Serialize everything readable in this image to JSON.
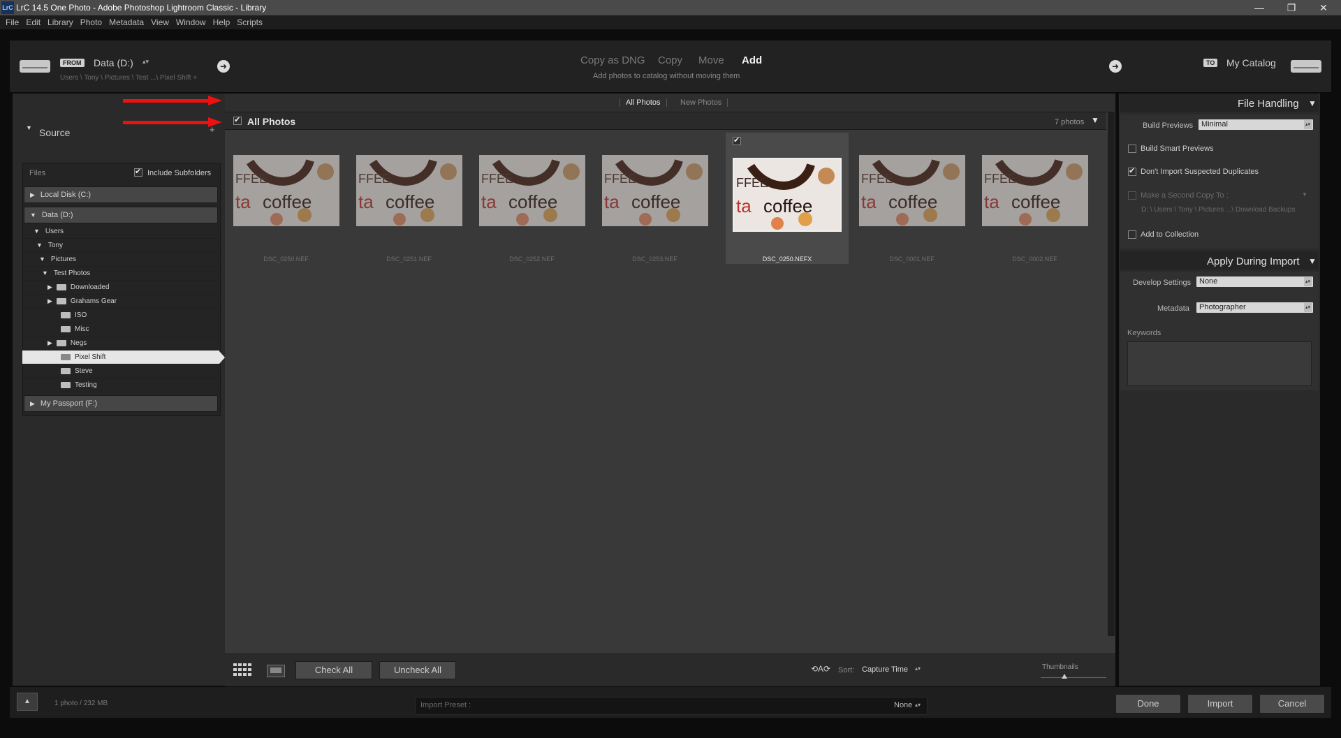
{
  "window": {
    "app_icon": "LrC",
    "title": "LrC 14.5 One Photo - Adobe Photoshop Lightroom Classic - Library",
    "min": "—",
    "max": "❐",
    "close": "✕"
  },
  "menu": [
    "File",
    "Edit",
    "Library",
    "Photo",
    "Metadata",
    "View",
    "Window",
    "Help",
    "Scripts"
  ],
  "header": {
    "from_tag": "FROM",
    "source_drive": "Data (D:)",
    "source_path": "Users \\ Tony \\ Pictures \\ Test ...\\ Pixel Shift +",
    "modes": [
      "Copy as DNG",
      "Copy",
      "Move",
      "Add"
    ],
    "active_mode": "Add",
    "mode_desc": "Add photos to catalog without moving them",
    "to_tag": "TO",
    "destination": "My Catalog",
    "arrow": "➜"
  },
  "left": {
    "source_label": "Source",
    "files_label": "Files",
    "include_subfolders": "Include Subfolders",
    "drives": {
      "c": "Local Disk (C:)",
      "d": "Data (D:)",
      "f": "My Passport (F:)"
    },
    "tree": {
      "users": "Users",
      "tony": "Tony",
      "pictures": "Pictures",
      "test_photos": "Test Photos",
      "downloaded": "Downloaded",
      "grahams_gear": "Grahams Gear",
      "iso": "ISO",
      "misc": "Misc",
      "negs": "Negs",
      "pixel_shift": "Pixel Shift",
      "steve": "Steve",
      "testing": "Testing"
    }
  },
  "center": {
    "filters": [
      "All Photos",
      "New Photos"
    ],
    "group_title": "All Photos",
    "photo_count": "7 photos",
    "thumb_text": {
      "coffee": "coffee",
      "fee": "FFEE",
      "ta": "ta"
    },
    "thumbs": [
      "DSC_0250.NEF",
      "DSC_0251.NEF",
      "DSC_0252.NEF",
      "DSC_0253.NEF",
      "DSC_0250.NEFX",
      "DSC_0001.NEF",
      "DSC_0002.NEF"
    ],
    "check_all": "Check All",
    "uncheck_all": "Uncheck All",
    "sort_label": "Sort:",
    "sort_value": "Capture Time",
    "thumbnails_label": "Thumbnails"
  },
  "right": {
    "file_handling": "File Handling",
    "build_previews_label": "Build Previews",
    "build_previews_value": "Minimal",
    "smart_previews": "Build Smart Previews",
    "no_duplicates": "Don't Import Suspected Duplicates",
    "second_copy": "Make a Second Copy To :",
    "second_copy_path": "D: \\ Users \\ Tony \\ Pictures ...\\ Download Backups",
    "add_collection": "Add to Collection",
    "apply_during_import": "Apply During Import",
    "develop_label": "Develop Settings",
    "develop_value": "None",
    "metadata_label": "Metadata",
    "metadata_value": "Photographer",
    "keywords_label": "Keywords"
  },
  "bottom": {
    "summary": "1 photo / 232 MB",
    "preset_label": "Import Preset :",
    "preset_value": "None",
    "done": "Done",
    "import": "Import",
    "cancel": "Cancel"
  },
  "colors": {
    "annotation_arrow": "#e11111",
    "selected_row": "#e6e6e6"
  }
}
